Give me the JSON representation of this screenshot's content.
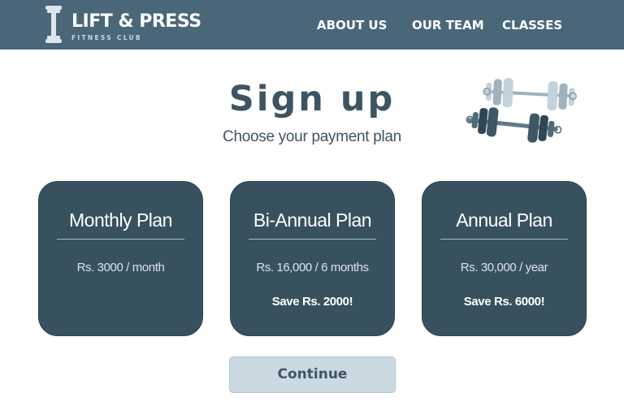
{
  "brand": {
    "name": "LIFT & PRESS",
    "tagline": "FITNESS CLUB",
    "icon": "dumbbell-icon"
  },
  "nav": {
    "items": [
      {
        "label": "ABOUT US"
      },
      {
        "label": "OUR TEAM"
      },
      {
        "label": "CLASSES"
      }
    ]
  },
  "page": {
    "title": "Sign up",
    "subtitle": "Choose your payment plan",
    "illustration": "dumbbells-icon"
  },
  "plans": [
    {
      "name": "Monthly Plan",
      "price": "Rs. 3000  / month",
      "saving": ""
    },
    {
      "name": "Bi-Annual Plan",
      "price": "Rs. 16,000  / 6 months",
      "saving": "Save Rs. 2000!"
    },
    {
      "name": "Annual Plan",
      "price": "Rs. 30,000  / year",
      "saving": "Save Rs. 6000!"
    }
  ],
  "actions": {
    "continue_label": "Continue"
  },
  "colors": {
    "header": "#4a6779",
    "card": "#38515f",
    "button": "#cbdae2",
    "text_dark": "#3c5464"
  }
}
